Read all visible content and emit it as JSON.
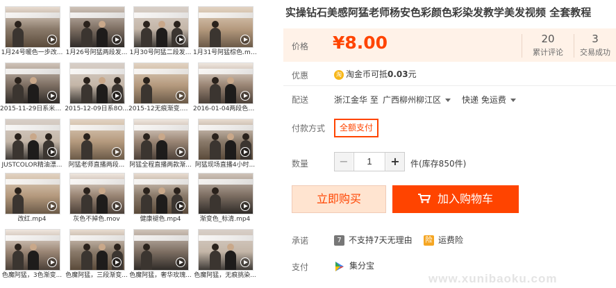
{
  "product": {
    "title": "实操钻石美感阿猛老师杨安色彩颜色彩染发教学美发视频 全套教程",
    "price_label": "价格",
    "price": "¥8.00",
    "reviews_count": "20",
    "reviews_label": "累计评论",
    "sales_count": "3",
    "sales_label": "交易成功"
  },
  "promo": {
    "label": "优惠",
    "coin_icon": "taobao-coin-icon",
    "text": "淘金币可抵",
    "amount": "0.03",
    "unit": "元"
  },
  "shipping": {
    "label": "配送",
    "from": "浙江金华 至",
    "to": "广西柳州柳江区",
    "method": "快递 免运费"
  },
  "payment_method": {
    "label": "付款方式",
    "selected": "全额支付"
  },
  "quantity": {
    "label": "数量",
    "value": "1",
    "minus": "−",
    "plus": "+",
    "stock": "件(库存850件)"
  },
  "actions": {
    "buy_now": "立即购买",
    "add_to_cart": "加入购物车"
  },
  "promise": {
    "label": "承诺",
    "no_return": "不支持7天无理由",
    "shipping_insurance": "运费险"
  },
  "pay": {
    "label": "支付",
    "method": "集分宝"
  },
  "watermark": "www.xunibaoku.com",
  "colors": {
    "accent": "#ff4400",
    "price_bg": "#fff2e8"
  },
  "videos": [
    {
      "caption": "1月24号暖色一步改..."
    },
    {
      "caption": "1月26号阿猛两段发..."
    },
    {
      "caption": "1月30号阿猛二段发..."
    },
    {
      "caption": "1月31号阿猛棕色.mp4"
    },
    {
      "caption": "2015-11-29日系米色..."
    },
    {
      "caption": "2015-12-09日系8O..."
    },
    {
      "caption": "2015-12无痕渐变.mov"
    },
    {
      "caption": "2016-01-04两段色染..."
    },
    {
      "caption": "JUSTCOLOR精油漂..."
    },
    {
      "caption": "阿猛老师直播两段..."
    },
    {
      "caption": "阿猛全程直播两款渐..."
    },
    {
      "caption": "阿猛现场直播4小时..."
    },
    {
      "caption": "改红.mp4"
    },
    {
      "caption": "灰色不掉色.mov"
    },
    {
      "caption": "健康褪色.mp4"
    },
    {
      "caption": "渐变色_标清.mp4"
    },
    {
      "caption": "色魔阿猛，3色渐变..."
    },
    {
      "caption": "色魔阿猛，三段渐变..."
    },
    {
      "caption": "色魔阿猛，奢华玫瑰..."
    },
    {
      "caption": "色魔阿猛，无痕挑染..."
    }
  ]
}
